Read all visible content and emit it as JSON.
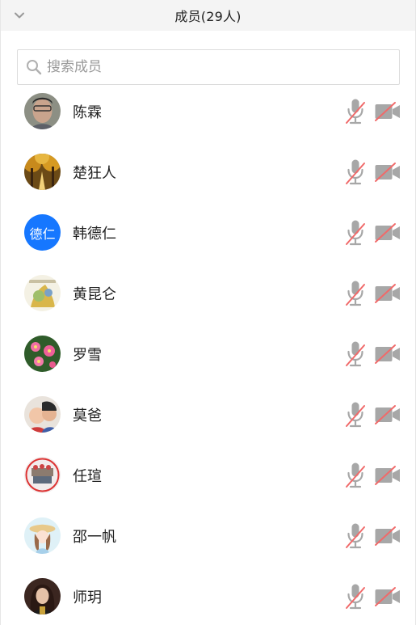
{
  "header": {
    "title": "成员(29人)"
  },
  "search": {
    "placeholder": "搜索成员"
  },
  "members": [
    {
      "name": "陈霖",
      "avatar_style": "photo-man"
    },
    {
      "name": "楚狂人",
      "avatar_style": "photo-forest"
    },
    {
      "name": "韩德仁",
      "avatar_style": "text",
      "avatar_text": "德仁"
    },
    {
      "name": "黄昆仑",
      "avatar_style": "photo-art"
    },
    {
      "name": "罗雪",
      "avatar_style": "photo-flowers"
    },
    {
      "name": "莫爸",
      "avatar_style": "photo-kids"
    },
    {
      "name": "任瑄",
      "avatar_style": "photo-badge"
    },
    {
      "name": "邵一帆",
      "avatar_style": "photo-cartoon"
    },
    {
      "name": "师玥",
      "avatar_style": "photo-girl"
    }
  ],
  "colors": {
    "accent": "#1677ff",
    "muted_icon": "#9a9a9a",
    "slash": "#f06a6a"
  }
}
